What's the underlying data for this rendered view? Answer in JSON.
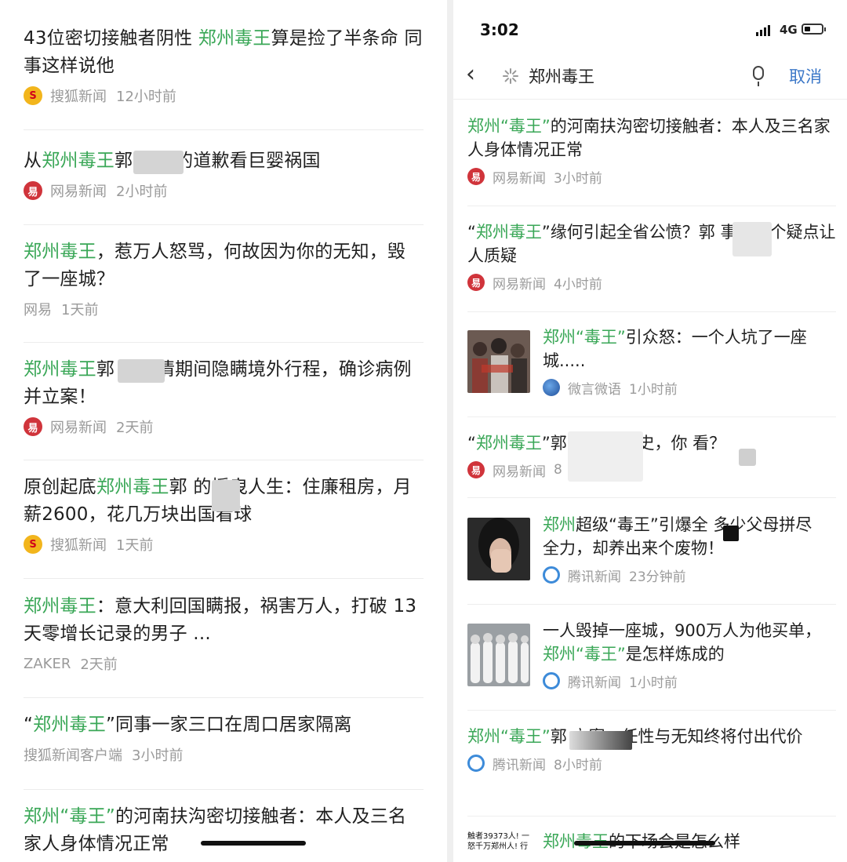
{
  "left": {
    "items": [
      {
        "pre": "43位密切接触者阴性 ",
        "hl": "郑州毒王",
        "post": "算是捡了半条命 同事这样说他",
        "source": "搜狐新闻",
        "time": "12小时前",
        "icon": "sohu-logo-icon"
      },
      {
        "pre": "从",
        "hl": "郑州毒王",
        "post": "郭  他妈的道歉看巨婴祸国",
        "source": "网易新闻",
        "time": "2小时前",
        "icon": "netease-logo-icon"
      },
      {
        "pre": "",
        "hl": "郑州毒王",
        "post": "，惹万人怒骂，何故因为你的无知，毁了一座城？",
        "source": "网易",
        "time": "1天前",
        "icon": ""
      },
      {
        "pre": "",
        "hl": "郑州毒王",
        "post": "郭  ，疫情期间隐瞒境外行程，确诊病例并立案！",
        "source": "网易新闻",
        "time": "2天前",
        "icon": "netease-logo-icon"
      },
      {
        "pre": "原创起底",
        "hl": "郑州毒王",
        "post": "郭  的摇曳人生：住廉租房，月薪2600，花几万块出国看球",
        "source": "搜狐新闻",
        "time": "1天前",
        "icon": "sohu-logo-icon"
      },
      {
        "pre": "",
        "hl": "郑州毒王",
        "post": "：意大利回国瞒报，祸害万人，打破 13 天零增长记录的男子 ...",
        "source": "ZAKER",
        "time": "2天前",
        "icon": ""
      },
      {
        "pre": "“",
        "hl": "郑州毒王",
        "post": "”同事一家三口在周口居家隔离",
        "source": "搜狐新闻客户端",
        "time": "3小时前",
        "icon": ""
      },
      {
        "pre": "",
        "hl": "郑州“毒王”",
        "post": "的河南扶沟密切接触者：本人及三名家人身体情况正常",
        "source": "",
        "time": "",
        "icon": ""
      }
    ]
  },
  "right": {
    "status": {
      "time": "3:02",
      "network": "4G"
    },
    "search": {
      "query": "郑州毒王",
      "cancel": "取消"
    },
    "items": [
      {
        "pre": "",
        "hl": "郑州“毒王”",
        "post": "的河南扶沟密切接触者：本人及三名家人身体情况正常",
        "source": "网易新闻",
        "time": "3小时前",
        "icon": "netease-logo-icon",
        "thumb": ""
      },
      {
        "pre": "“",
        "hl": "郑州毒王",
        "post": "”缘何引起全省公愤？郭   事件多个疑点让人质疑",
        "source": "网易新闻",
        "time": "4小时前",
        "icon": "netease-logo-icon",
        "thumb": ""
      },
      {
        "pre": "",
        "hl": "郑州“毒王”",
        "post": "引众怒：一个人坑了一座城.....",
        "source": "微言微语",
        "time": "1小时前",
        "icon": "weiyan-logo-icon",
        "thumb": "crowd-photo"
      },
      {
        "pre": "“",
        "hl": "郑州毒王",
        "post": "”郭  隐瞒旅居史，你  看？",
        "source": "网易新闻",
        "time": "8",
        "icon": "netease-logo-icon",
        "thumb": ""
      },
      {
        "pre": "",
        "hl": "郑州",
        "post": "超级“毒王”引爆全  多少父母拼尽全力，却养出来个废物！",
        "source": "腾讯新闻",
        "time": "23分钟前",
        "icon": "tencent-logo-icon",
        "thumb": "woman-photo"
      },
      {
        "pre": "一人毁掉一座城，900万人为他买单，",
        "hl": "郑州“毒王”",
        "post": "是怎样炼成的",
        "source": "腾讯新闻",
        "time": "1小时前",
        "icon": "tencent-logo-icon",
        "thumb": "hazmat-photo"
      },
      {
        "pre": "",
        "hl": "郑州“毒王”",
        "post": "郭  立案，任性与无知终将付出代价",
        "source": "腾讯新闻",
        "time": "8小时前",
        "icon": "tencent-logo-icon",
        "thumb": ""
      },
      {
        "pre": "",
        "hl": "郑州毒王",
        "post": "的下场会是怎么样",
        "source": "",
        "time": "",
        "icon": "",
        "thumb": "text-thumb",
        "thumb_text": "触者39373人! 一怒千万郑州人! 行"
      }
    ]
  }
}
